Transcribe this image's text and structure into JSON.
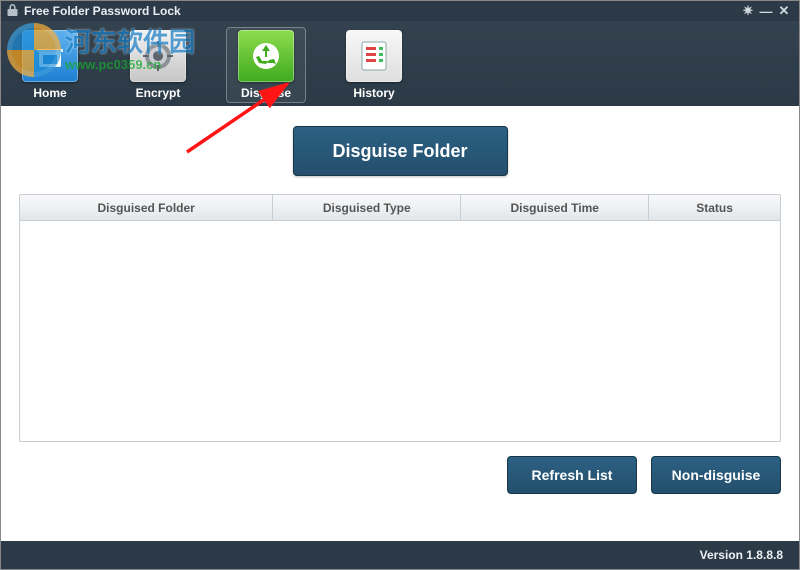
{
  "window": {
    "title": "Free Folder Password Lock"
  },
  "toolbar": {
    "items": [
      {
        "label": "Home"
      },
      {
        "label": "Encrypt"
      },
      {
        "label": "Disguise"
      },
      {
        "label": "History"
      }
    ]
  },
  "main": {
    "primary_button": "Disguise Folder",
    "columns": {
      "folder": "Disguised Folder",
      "type": "Disguised Type",
      "time": "Disguised Time",
      "status": "Status"
    },
    "refresh_button": "Refresh List",
    "nondisguise_button": "Non-disguise"
  },
  "footer": {
    "version_label": "Version 1.8.8.8"
  },
  "watermark": {
    "brand": "河东软件园",
    "url": "www.pc0359.cn"
  }
}
